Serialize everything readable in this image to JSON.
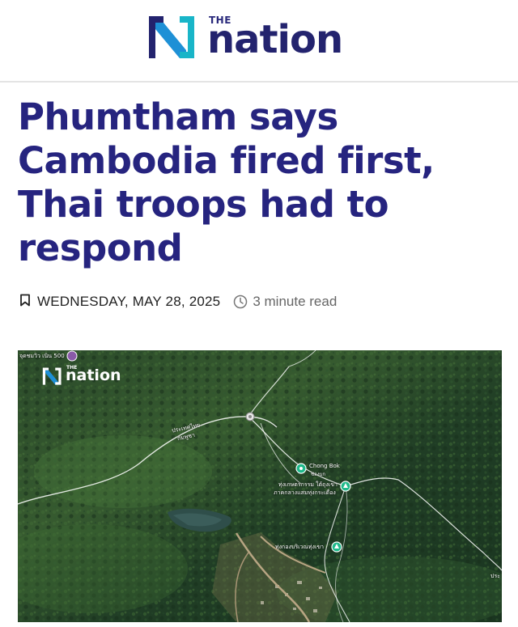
{
  "brand": {
    "the": "THE",
    "name": "nation",
    "colors": {
      "navy": "#23236e",
      "blue": "#1e90d6",
      "teal": "#19b5c8"
    }
  },
  "article": {
    "headline": "Phumtham says Cambodia fired first, Thai troops had to respond",
    "date": "WEDNESDAY, MAY 28, 2025",
    "read_time": "3 minute read",
    "icons": {
      "bookmark": "bookmark-icon",
      "clock": "clock-icon"
    }
  },
  "image": {
    "watermark_the": "THE",
    "watermark_name": "nation",
    "corner_text": "จุดชมวิว เนิน 500",
    "place_label": "Chong Bok",
    "place_sublabel": "ช่องบก",
    "road_label_1": "ประเทศไทย",
    "road_label_2": "กัมพูชา",
    "marker_label_1": "ทุ่งเกษตรกรรม ใต้ถุงเขา",
    "marker_label_2": "ภาคกลางแสมทุ่งกระเดื่อง",
    "marker_label_3": "ทุ่งกองบริเวณทุ่งเขา",
    "edge_label": "ประ"
  }
}
